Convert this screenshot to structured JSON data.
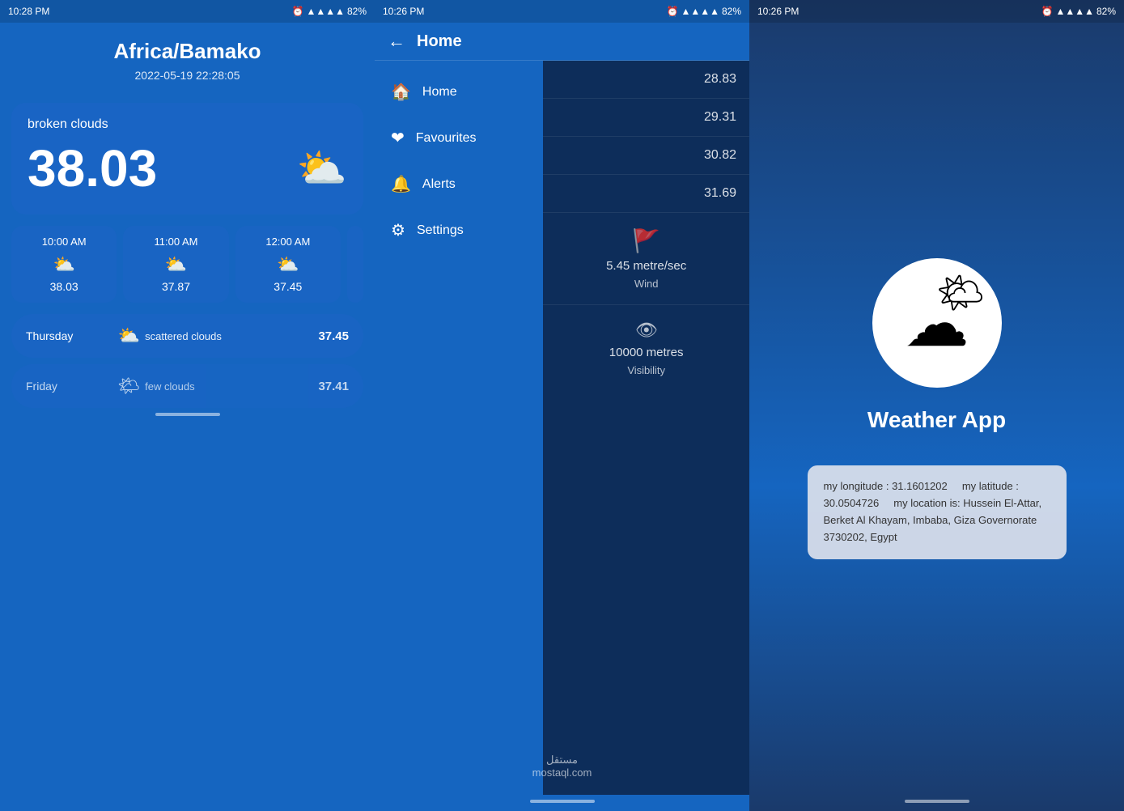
{
  "screen1": {
    "status": {
      "time": "10:28 PM",
      "battery": "82%"
    },
    "city": "Africa/Bamako",
    "date": "2022-05-19 22:28:05",
    "condition": "broken clouds",
    "temperature": "38.03",
    "hourly": [
      {
        "time": "10:00 AM",
        "icon": "🌤",
        "temp": "38.03"
      },
      {
        "time": "11:00 AM",
        "icon": "🌤",
        "temp": "37.87"
      },
      {
        "time": "12:00 AM",
        "icon": "🌤",
        "temp": "37.45"
      }
    ],
    "daily": [
      {
        "day": "Thursday",
        "icon": "🌤",
        "condition": "scattered clouds",
        "temp": "37.45"
      },
      {
        "day": "Friday",
        "icon": "🌤",
        "condition": "few clouds",
        "temp": "37.41"
      }
    ]
  },
  "screen2": {
    "status": {
      "time": "10:26 PM",
      "battery": "82%"
    },
    "title": "Home",
    "menu": [
      {
        "icon": "🏠",
        "label": "Home"
      },
      {
        "icon": "❤",
        "label": "Favourites"
      },
      {
        "icon": "🔔",
        "label": "Alerts"
      },
      {
        "icon": "⚙",
        "label": "Settings"
      }
    ],
    "data_values": [
      "28.83",
      "29.31",
      "30.82",
      "31.69"
    ],
    "wind": {
      "value": "5.45 metre/sec",
      "label": "Wind",
      "icon": "🚩"
    },
    "visibility": {
      "value": "10000 metres",
      "label": "Visibility",
      "icon": "👁"
    },
    "watermark": "مستقل\nmostaql.com"
  },
  "screen3": {
    "status": {
      "time": "10:26 PM",
      "battery": "82%"
    },
    "app_title": "Weather App",
    "info": {
      "longitude_label": "my longitude :",
      "longitude_value": "31.1601202",
      "latitude_label": "my latitude :",
      "latitude_value": "30.0504726",
      "location_label": "my location is:",
      "location_value": "Hussein El-Attar, Berket Al Khayam, Imbaba, Giza Governorate 3730202, Egypt"
    }
  }
}
